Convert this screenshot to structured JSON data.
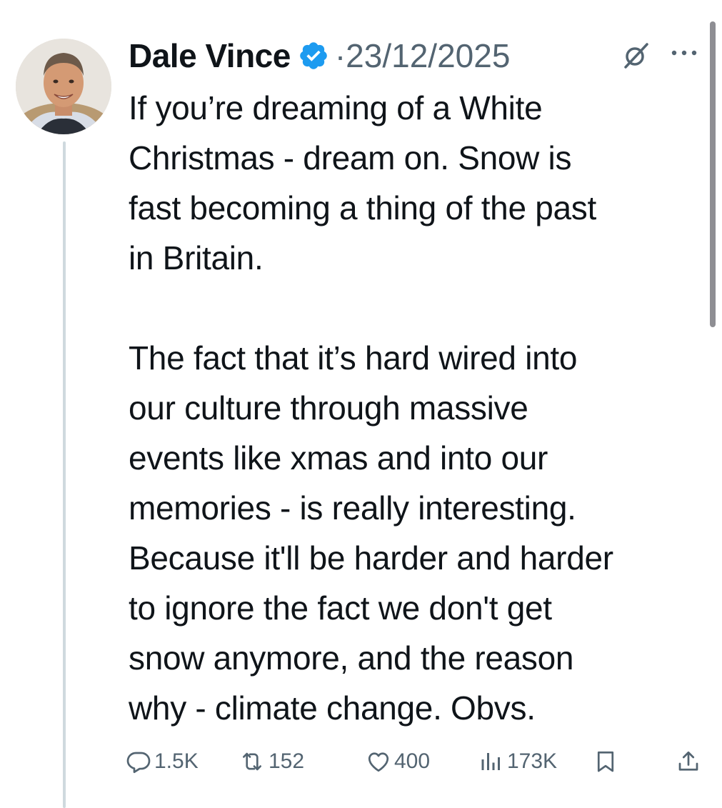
{
  "post": {
    "author_name": "Dale Vince",
    "verified": true,
    "separator": "·",
    "date": "23/12/2025",
    "text": "If you’re dreaming of a White\nChristmas - dream on. Snow is\nfast becoming a thing of the past\nin Britain.\n\nThe fact that it’s hard wired into\nour culture through massive\nevents like xmas and into our\nmemories - is really interesting.\nBecause it'll be harder and harder\nto ignore the fact we don't get\nsnow anymore, and the reason\nwhy - climate change. Obvs."
  },
  "actions": {
    "replies": "1.5K",
    "reposts": "152",
    "likes": "400",
    "views": "173K"
  },
  "icons": {
    "verified": "verified-badge-icon",
    "grok": "grok-icon",
    "more": "more-options-icon",
    "reply": "reply-icon",
    "repost": "repost-icon",
    "like": "heart-icon",
    "views": "views-icon",
    "bookmark": "bookmark-icon",
    "share": "share-icon"
  },
  "colors": {
    "text": "#0f1419",
    "secondary": "#536471",
    "verified": "#1d9bf0",
    "thread_line": "#cfd9de"
  }
}
